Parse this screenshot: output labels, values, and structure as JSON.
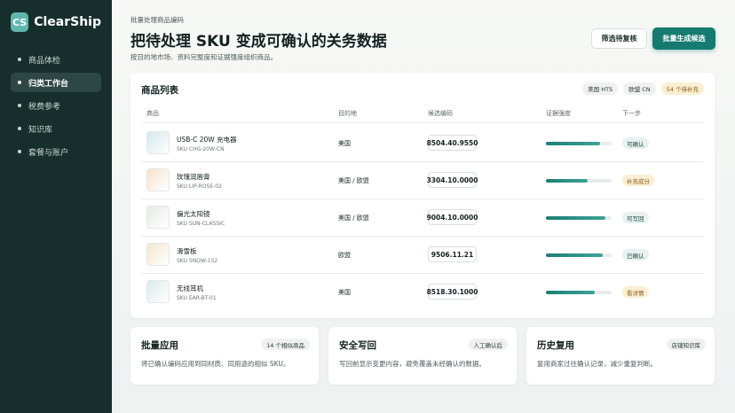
{
  "app": {
    "logo_mark": "CS",
    "name": "ClearShip"
  },
  "sidebar": {
    "items": [
      {
        "label": "商品体检",
        "active": false
      },
      {
        "label": "归类工作台",
        "active": true
      },
      {
        "label": "税费参考",
        "active": false
      },
      {
        "label": "知识库",
        "active": false
      },
      {
        "label": "套餐与账户",
        "active": false
      }
    ]
  },
  "header": {
    "kicker": "批量处理商品编码",
    "title": "把待处理 SKU 变成可确认的关务数据",
    "subtitle": "按目的地市场、资料完整度和证据强度组织商品。",
    "secondary_button": "筛选待复核",
    "primary_button": "批量生成候选"
  },
  "product_list": {
    "title": "商品列表",
    "chips": [
      "美国 HTS",
      "欧盟 CN",
      "54 个待补充"
    ],
    "columns": [
      "商品",
      "目的地",
      "候选编码",
      "证据强度",
      "下一步"
    ],
    "rows": [
      {
        "name": "USB-C 20W 充电器",
        "sku": "SKU CHG-20W-CN",
        "destination": "美国",
        "code": "8504.40.9550",
        "evidence": 0.82,
        "status": "可确认",
        "status_kind": "normal",
        "thumb_color": "#d6e8ec"
      },
      {
        "name": "玫瑰润唇膏",
        "sku": "SKU LIP-ROSE-02",
        "destination": "美国 / 欧盟",
        "code": "3304.10.0000",
        "evidence": 0.64,
        "status": "补充成分",
        "status_kind": "warn",
        "thumb_color": "#f7e2cf"
      },
      {
        "name": "偏光太阳镜",
        "sku": "SKU SUN-CLASSIC",
        "destination": "美国 / 欧盟",
        "code": "9004.10.0000",
        "evidence": 0.9,
        "status": "可写回",
        "status_kind": "normal",
        "thumb_color": "#e5ebe4"
      },
      {
        "name": "滑雪板",
        "sku": "SKU SNOW-152",
        "destination": "欧盟",
        "code": "9506.11.21",
        "evidence": 0.86,
        "status": "已确认",
        "status_kind": "normal",
        "thumb_color": "#f5e6cf"
      },
      {
        "name": "无线耳机",
        "sku": "SKU EAR-BT-01",
        "destination": "美国",
        "code": "8518.30.1000",
        "evidence": 0.74,
        "status": "看详情",
        "status_kind": "warn",
        "thumb_color": "#dbeaee"
      }
    ]
  },
  "cards": [
    {
      "title": "批量应用",
      "chip": "14 个相似商品",
      "desc": "将已确认编码应用到同材质、同用途的相似 SKU。"
    },
    {
      "title": "安全写回",
      "chip": "人工确认后",
      "desc": "写回前显示变更内容，避免覆盖未经确认的数据。"
    },
    {
      "title": "历史复用",
      "chip": "店铺知识库",
      "desc": "复用商家过往确认记录，减少重复判断。"
    }
  ]
}
